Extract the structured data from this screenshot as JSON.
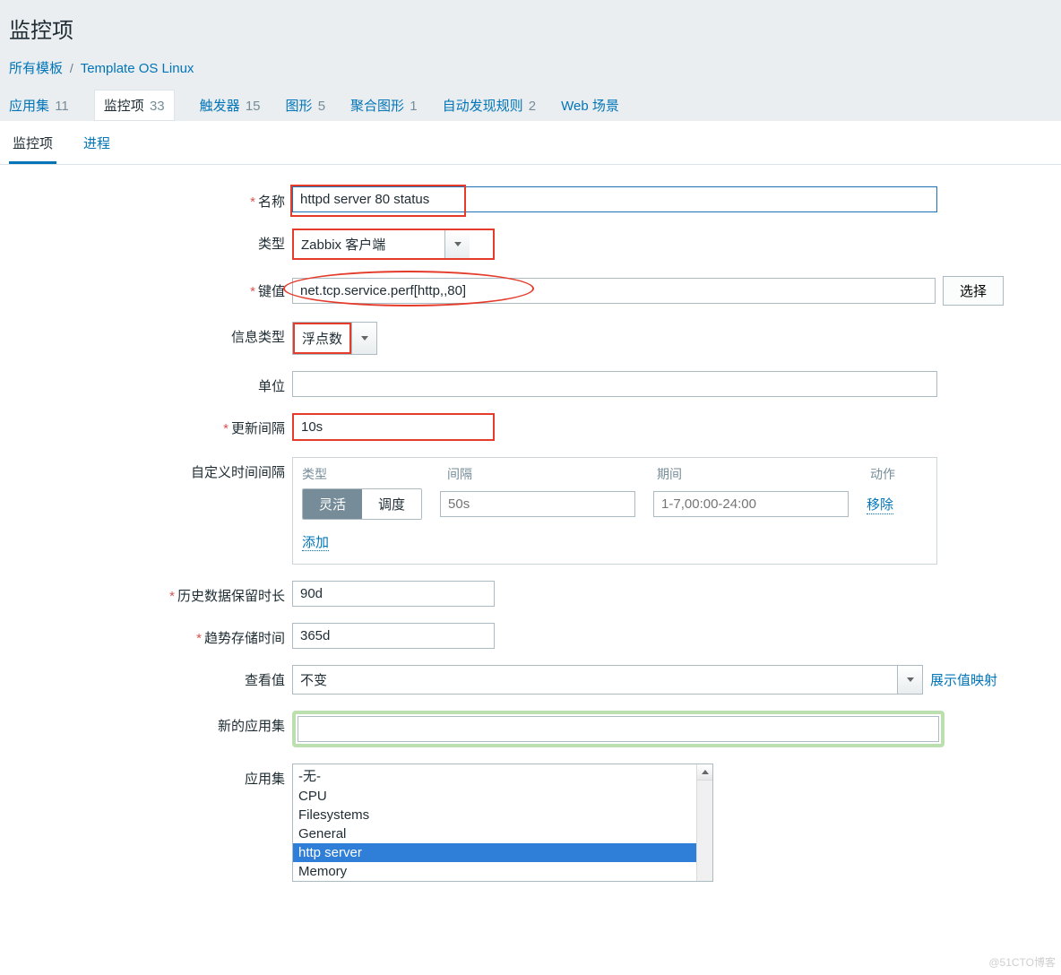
{
  "page_title": "监控项",
  "breadcrumb": {
    "all_templates": "所有模板",
    "template_name": "Template OS Linux"
  },
  "secondary_nav": {
    "apps": {
      "label": "应用集",
      "count": "11"
    },
    "items": {
      "label": "监控项",
      "count": "33"
    },
    "triggers": {
      "label": "触发器",
      "count": "15"
    },
    "graphs": {
      "label": "图形",
      "count": "5"
    },
    "screens": {
      "label": "聚合图形",
      "count": "1"
    },
    "discovery": {
      "label": "自动发现规则",
      "count": "2"
    },
    "web": {
      "label": "Web 场景"
    }
  },
  "tabs": {
    "item": "监控项",
    "process": "进程"
  },
  "labels": {
    "name": "名称",
    "type": "类型",
    "key": "键值",
    "info_type": "信息类型",
    "units": "单位",
    "update_interval": "更新间隔",
    "custom_interval": "自定义时间间隔",
    "history": "历史数据保留时长",
    "trends": "趋势存储时间",
    "show_value": "查看值",
    "new_app": "新的应用集",
    "apps": "应用集"
  },
  "buttons": {
    "select_key": "选择",
    "show_value_map": "展示值映射"
  },
  "custom_interval_table": {
    "headers": {
      "type": "类型",
      "interval": "间隔",
      "period": "期间",
      "action": "动作"
    },
    "toggle": {
      "flexible": "灵活",
      "scheduling": "调度"
    },
    "row": {
      "interval_placeholder": "50s",
      "period_placeholder": "1-7,00:00-24:00"
    },
    "remove": "移除",
    "add": "添加"
  },
  "values": {
    "name": "httpd server 80 status",
    "type": "Zabbix 客户端",
    "key": "net.tcp.service.perf[http,,80]",
    "info_type": "浮点数",
    "units": "",
    "update_interval": "10s",
    "history": "90d",
    "trends": "365d",
    "show_value": "不变",
    "new_app": ""
  },
  "applications": [
    "-无-",
    "CPU",
    "Filesystems",
    "General",
    "http server",
    "Memory"
  ],
  "applications_selected_index": 4,
  "watermark": "@51CTO博客"
}
